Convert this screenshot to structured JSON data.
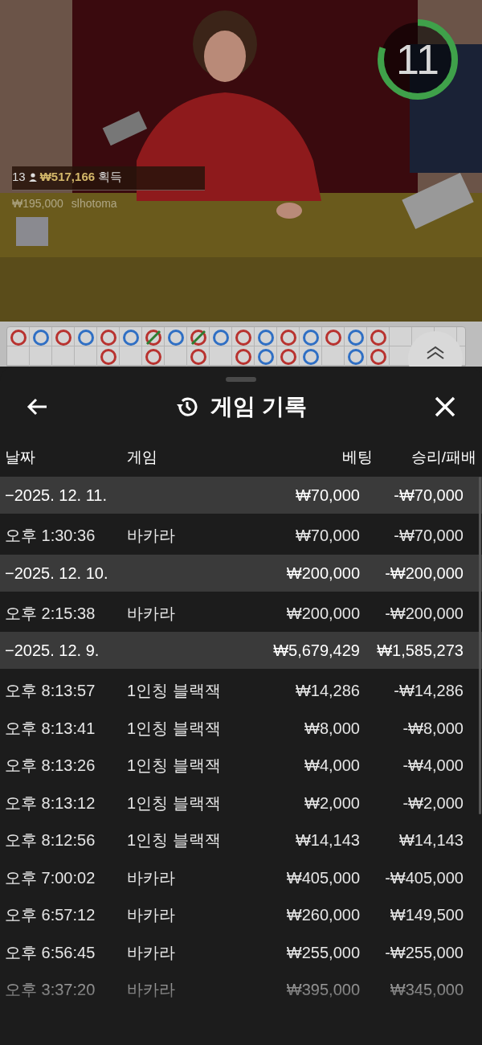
{
  "video": {
    "timer": {
      "text": "11",
      "level": 0.8
    },
    "win_notice": {
      "count": "13",
      "amount": "₩517,166",
      "label": "획득"
    },
    "bet_notice": {
      "amount": "₩195,000",
      "user": "slhotoma"
    }
  },
  "bead_road": {
    "rows": [
      {
        "cells": [
          {
            "color": "#b8322f",
            "tie": false
          },
          {
            "color": "#2f6fc4",
            "tie": false
          },
          {
            "color": "#b8322f",
            "tie": false
          },
          {
            "color": "#2f6fc4",
            "tie": false
          },
          {
            "color": "#b8322f",
            "tie": false
          },
          {
            "color": "#2f6fc4",
            "tie": false
          },
          {
            "color": "#b8322f",
            "tie": true
          },
          {
            "color": "#2f6fc4",
            "tie": false
          },
          {
            "color": "#b8322f",
            "tie": true
          },
          {
            "color": "#2f6fc4",
            "tie": false
          },
          {
            "color": "#b8322f",
            "tie": false
          },
          {
            "color": "#2f6fc4",
            "tie": false
          },
          {
            "color": "#b8322f",
            "tie": false
          },
          {
            "color": "#2f6fc4",
            "tie": false
          },
          {
            "color": "#b8322f",
            "tie": false
          },
          {
            "color": "#2f6fc4",
            "tie": false
          },
          {
            "color": "#b8322f",
            "tie": false
          }
        ]
      },
      {
        "cells": [
          null,
          null,
          null,
          null,
          {
            "color": "#b8322f",
            "tie": false
          },
          null,
          {
            "color": "#b8322f",
            "tie": false
          },
          null,
          {
            "color": "#b8322f",
            "tie": false
          },
          null,
          {
            "color": "#b8322f",
            "tie": false
          },
          {
            "color": "#2f6fc4",
            "tie": false
          },
          {
            "color": "#b8322f",
            "tie": false
          },
          {
            "color": "#2f6fc4",
            "tie": false
          },
          null,
          {
            "color": "#2f6fc4",
            "tie": false
          },
          {
            "color": "#b8322f",
            "tie": false
          }
        ]
      }
    ]
  },
  "sheet": {
    "title": "게임 기록",
    "columns": [
      "날짜",
      "게임",
      "베팅",
      "승리/패배"
    ],
    "rows": [
      {
        "kind": "date",
        "date": "−2025. 12. 11.",
        "bet": "₩70,000",
        "result": "-₩70,000"
      },
      {
        "kind": "entry",
        "time": "오후 1:30:36",
        "game": "바카라",
        "bet": "₩70,000",
        "result": "-₩70,000"
      },
      {
        "kind": "date",
        "date": "−2025. 12. 10.",
        "bet": "₩200,000",
        "result": "-₩200,000"
      },
      {
        "kind": "entry",
        "time": "오후 2:15:38",
        "game": "바카라",
        "bet": "₩200,000",
        "result": "-₩200,000"
      },
      {
        "kind": "date",
        "date": "−2025. 12. 9.",
        "bet": "₩5,679,429",
        "result": "₩1,585,273"
      },
      {
        "kind": "entry",
        "time": "오후 8:13:57",
        "game": "1인칭 블랙잭",
        "bet": "₩14,286",
        "result": "-₩14,286"
      },
      {
        "kind": "entry",
        "time": "오후 8:13:41",
        "game": "1인칭 블랙잭",
        "bet": "₩8,000",
        "result": "-₩8,000"
      },
      {
        "kind": "entry",
        "time": "오후 8:13:26",
        "game": "1인칭 블랙잭",
        "bet": "₩4,000",
        "result": "-₩4,000"
      },
      {
        "kind": "entry",
        "time": "오후 8:13:12",
        "game": "1인칭 블랙잭",
        "bet": "₩2,000",
        "result": "-₩2,000"
      },
      {
        "kind": "entry",
        "time": "오후 8:12:56",
        "game": "1인칭 블랙잭",
        "bet": "₩14,143",
        "result": "₩14,143"
      },
      {
        "kind": "entry",
        "time": "오후 7:00:02",
        "game": "바카라",
        "bet": "₩405,000",
        "result": "-₩405,000"
      },
      {
        "kind": "entry",
        "time": "오후 6:57:12",
        "game": "바카라",
        "bet": "₩260,000",
        "result": "₩149,500"
      },
      {
        "kind": "entry",
        "time": "오후 6:56:45",
        "game": "바카라",
        "bet": "₩255,000",
        "result": "-₩255,000"
      },
      {
        "kind": "entry",
        "time": "오후 3:37:20",
        "game": "바카라",
        "bet": "₩395,000",
        "result": "₩345,000"
      }
    ]
  }
}
